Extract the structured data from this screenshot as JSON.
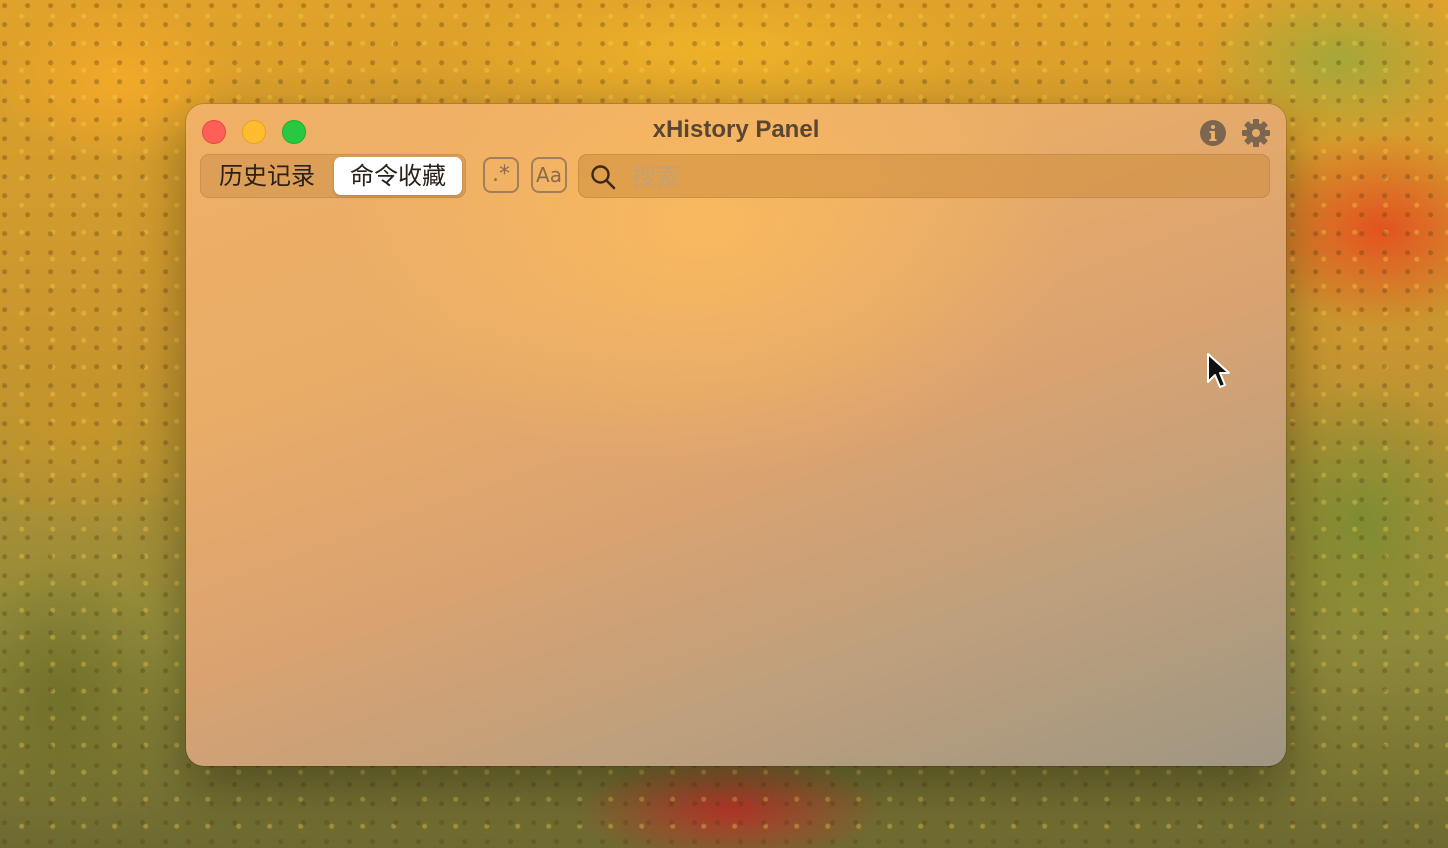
{
  "window": {
    "title": "xHistory Panel"
  },
  "tabs": [
    {
      "label": "历史记录",
      "selected": false
    },
    {
      "label": "命令收藏",
      "selected": true
    }
  ],
  "toggles": {
    "regex_label": ".*",
    "case_label": "Aa"
  },
  "search": {
    "placeholder": "搜索",
    "value": ""
  },
  "icons": {
    "info": "info-icon",
    "settings": "gear-icon",
    "search": "search-icon"
  },
  "colors": {
    "close": "#fe5f57",
    "minimize": "#febc2e",
    "maximize": "#28c840",
    "title_text": "#5a4632"
  }
}
